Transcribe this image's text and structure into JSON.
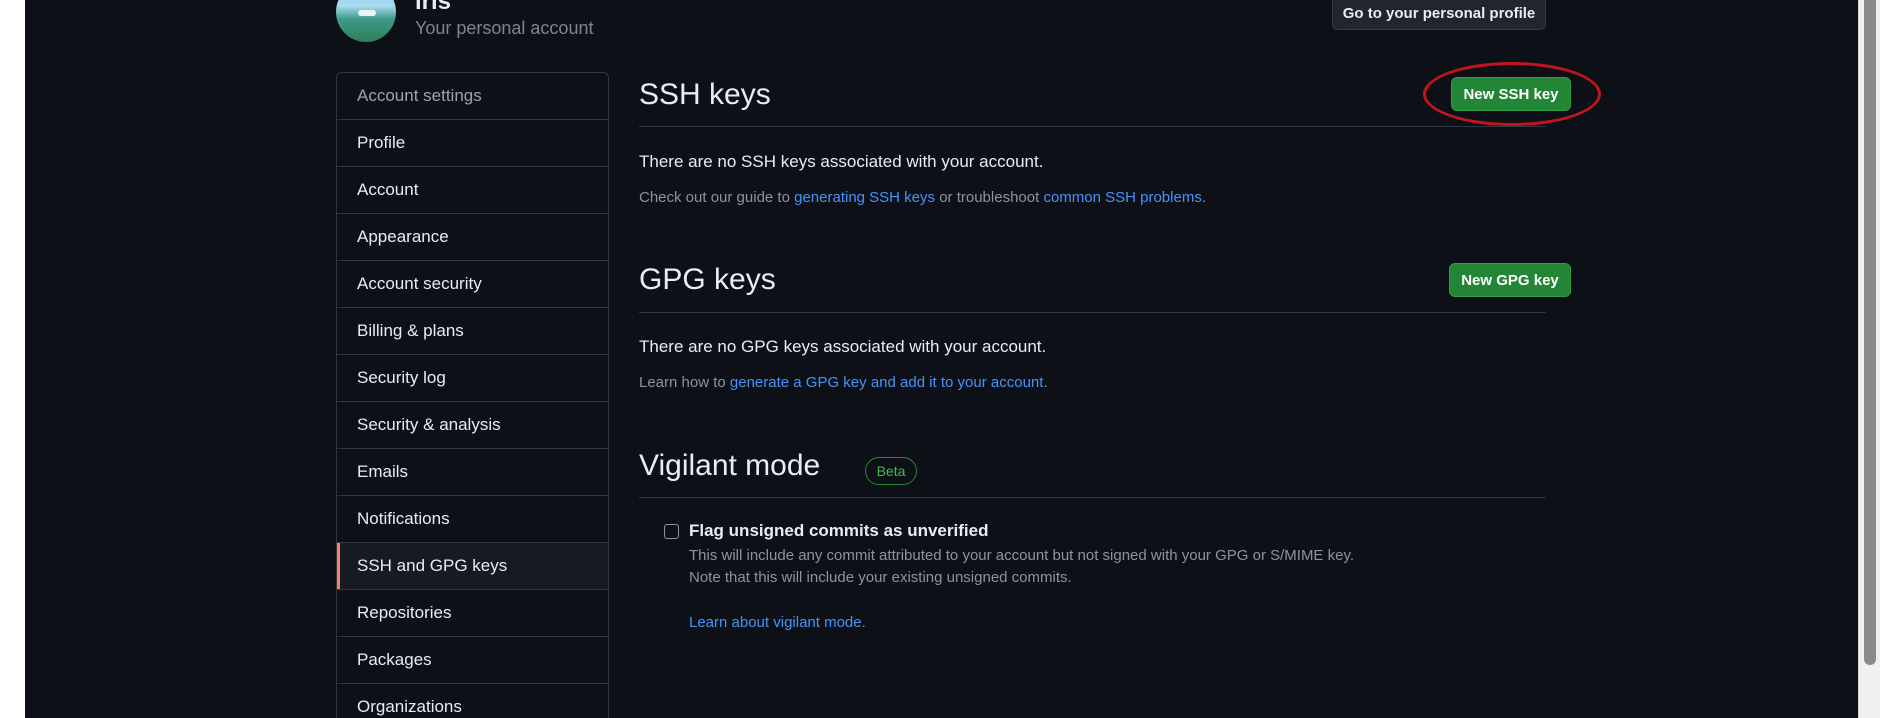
{
  "header": {
    "user_name": "iris",
    "account_sub": "Your personal account",
    "profile_button": "Go to your personal profile"
  },
  "sidebar": {
    "heading": "Account settings",
    "items": [
      {
        "label": "Profile"
      },
      {
        "label": "Account"
      },
      {
        "label": "Appearance"
      },
      {
        "label": "Account security"
      },
      {
        "label": "Billing & plans"
      },
      {
        "label": "Security log"
      },
      {
        "label": "Security & analysis"
      },
      {
        "label": "Emails"
      },
      {
        "label": "Notifications"
      },
      {
        "label": "SSH and GPG keys",
        "active": true
      },
      {
        "label": "Repositories"
      },
      {
        "label": "Packages"
      },
      {
        "label": "Organizations"
      }
    ]
  },
  "ssh": {
    "title": "SSH keys",
    "button": "New SSH key",
    "empty": "There are no SSH keys associated with your account.",
    "guide_prefix": "Check out our guide to ",
    "guide_link": "generating SSH keys",
    "guide_mid": " or troubleshoot ",
    "guide_link2": "common SSH problems",
    "guide_end": "."
  },
  "gpg": {
    "title": "GPG keys",
    "button": "New GPG key",
    "empty": "There are no GPG keys associated with your account.",
    "learn_prefix": "Learn how to ",
    "learn_link": "generate a GPG key and add it to your account",
    "learn_end": "."
  },
  "vigilant": {
    "title": "Vigilant mode",
    "badge": "Beta",
    "checkbox_label": "Flag unsigned commits as unverified",
    "checked": false,
    "desc_line1": "This will include any commit attributed to your account but not signed with your GPG or S/MIME key.",
    "desc_line2": "Note that this will include your existing unsigned commits.",
    "learn_link": "Learn about vigilant mode."
  },
  "colors": {
    "background": "#0d1117",
    "primary_button": "#238636",
    "link": "#4493f8",
    "active_indicator": "#f78166",
    "annotation": "#c0151f"
  }
}
